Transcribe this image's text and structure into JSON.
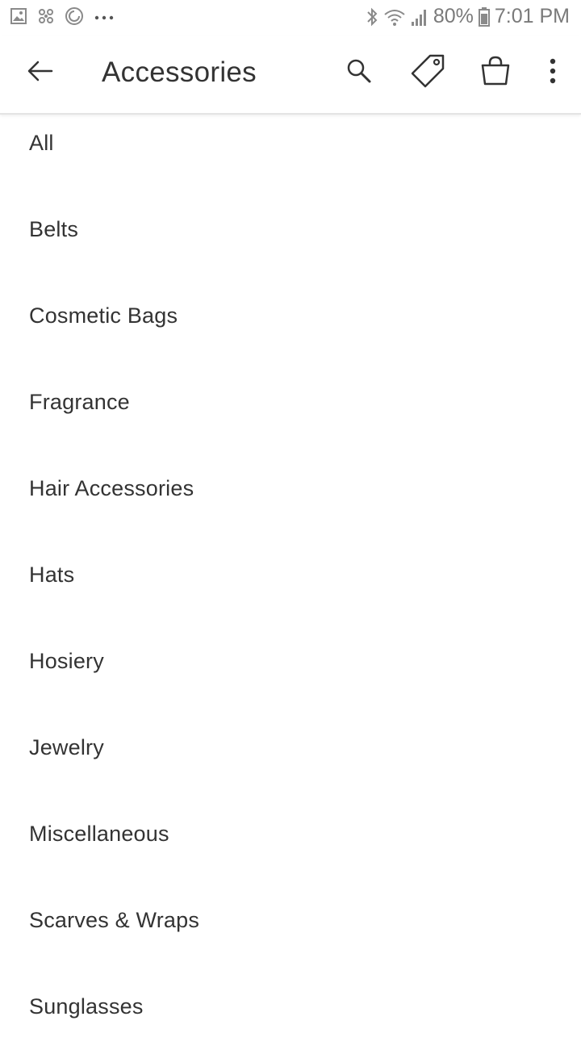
{
  "status_bar": {
    "left_icons": [
      "gallery-icon",
      "pinwheel-icon",
      "sync-icon",
      "more-dots-icon"
    ],
    "right_icons": [
      "bluetooth-icon",
      "wifi-icon",
      "signal-icon",
      "battery-icon"
    ],
    "battery": "80%",
    "time": "7:01 PM"
  },
  "appbar": {
    "title": "Accessories",
    "icons": [
      "back-arrow-icon",
      "search-icon",
      "tag-icon",
      "shopping-bag-icon",
      "overflow-menu-icon"
    ]
  },
  "categories": [
    "All",
    "Belts",
    "Cosmetic Bags",
    "Fragrance",
    "Hair Accessories",
    "Hats",
    "Hosiery",
    "Jewelry",
    "Miscellaneous",
    "Scarves & Wraps",
    "Sunglasses"
  ]
}
